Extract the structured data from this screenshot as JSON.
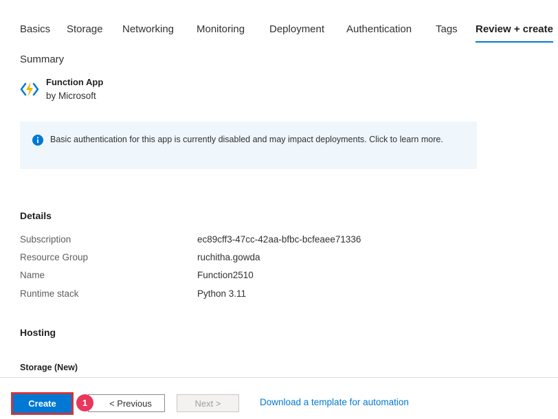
{
  "tabs": [
    "Basics",
    "Storage",
    "Networking",
    "Monitoring",
    "Deployment",
    "Authentication",
    "Tags",
    "Review + create"
  ],
  "active_tab": "Review + create",
  "summary": {
    "title": "Summary",
    "app_name": "Function App",
    "publisher": "by Microsoft",
    "icon": "azure-functions-icon"
  },
  "info_banner": {
    "icon": "info-icon",
    "text": "Basic authentication for this app is currently disabled and may impact deployments. Click to learn more."
  },
  "details": {
    "title": "Details",
    "rows": [
      {
        "label": "Subscription",
        "value": "ec89cff3-47cc-42aa-bfbc-bcfeaee71336"
      },
      {
        "label": "Resource Group",
        "value": "ruchitha.gowda"
      },
      {
        "label": "Name",
        "value": "Function2510"
      },
      {
        "label": "Runtime stack",
        "value": "Python 3.11"
      }
    ]
  },
  "hosting": {
    "title": "Hosting",
    "storage_title": "Storage (New)"
  },
  "footer": {
    "create_label": "Create",
    "badge_label": "1",
    "previous_label": "< Previous",
    "next_label": "Next >",
    "download_link": "Download a template for automation"
  },
  "colors": {
    "accent": "#0078d4",
    "highlight": "#d13438",
    "badge": "#e8365d",
    "info_bg": "#eff6fc"
  }
}
